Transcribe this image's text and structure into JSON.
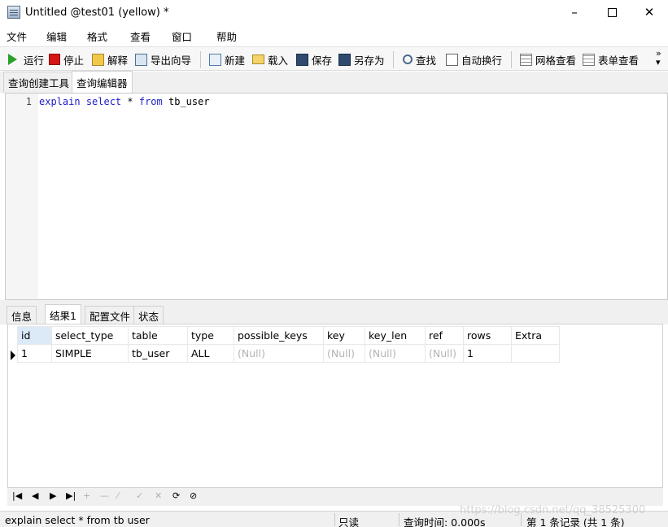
{
  "window": {
    "title": "Untitled @test01 (yellow) *"
  },
  "menu": [
    "文件",
    "编辑",
    "格式",
    "查看",
    "窗口",
    "帮助"
  ],
  "toolbar": {
    "run": "运行",
    "stop": "停止",
    "explain": "解释",
    "export_wizard": "导出向导",
    "new": "新建",
    "load": "载入",
    "save": "保存",
    "save_as": "另存为",
    "find": "查找",
    "word_wrap": "自动换行",
    "grid_view": "网格查看",
    "form_view": "表单查看"
  },
  "editor_tabs": [
    "查询创建工具",
    "查询编辑器"
  ],
  "editor": {
    "line_number": "1",
    "kw_explain": "explain",
    "kw_select": "select",
    "star": " * ",
    "kw_from": "from",
    "table_name": " tb_user"
  },
  "result_tabs": [
    "信息",
    "结果1",
    "配置文件",
    "状态"
  ],
  "result": {
    "columns": [
      "id",
      "select_type",
      "table",
      "type",
      "possible_keys",
      "key",
      "key_len",
      "ref",
      "rows",
      "Extra"
    ],
    "rows": [
      [
        "1",
        "SIMPLE",
        "tb_user",
        "ALL",
        "(Null)",
        "(Null)",
        "(Null)",
        "(Null)",
        "1",
        ""
      ]
    ]
  },
  "status": {
    "sql": "explain select * from tb user",
    "mode": "只读",
    "query_time": "查询时间: 0.000s",
    "records": "第 1 条记录 (共 1 条)"
  },
  "watermark": "https://blog.csdn.net/qq_38525300"
}
